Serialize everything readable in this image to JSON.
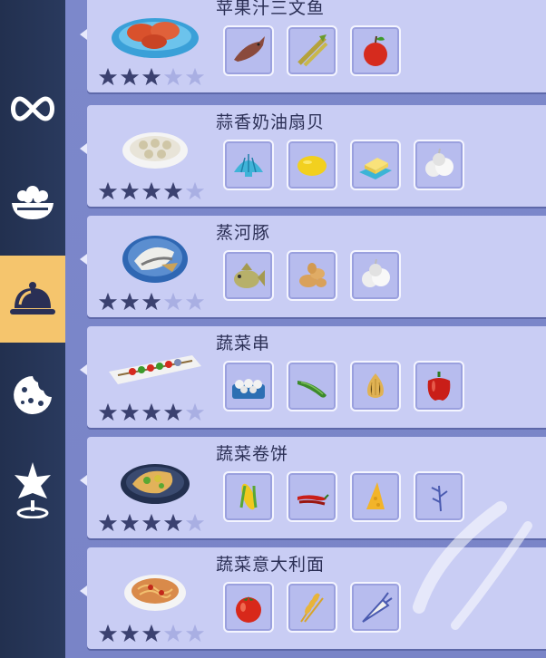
{
  "sidebar": {
    "items": [
      {
        "icon": "infinity-icon",
        "active": false
      },
      {
        "icon": "bowl-icon",
        "active": false
      },
      {
        "icon": "cloche-icon",
        "active": true
      },
      {
        "icon": "cookie-icon",
        "active": false
      },
      {
        "icon": "sparkle-pin-icon",
        "active": false
      }
    ]
  },
  "recipes": [
    {
      "name": "苹果汁三文鱼",
      "stars": 3,
      "max_stars": 5,
      "dish_icon": "salmon-dish-icon",
      "ingredients": [
        "fish-icon",
        "sugarcane-icon",
        "apple-icon"
      ]
    },
    {
      "name": "蒜香奶油扇贝",
      "stars": 4,
      "max_stars": 5,
      "dish_icon": "scallop-dish-icon",
      "ingredients": [
        "shell-icon",
        "lemon-icon",
        "butter-icon",
        "garlic-icon"
      ]
    },
    {
      "name": "蒸河豚",
      "stars": 3,
      "max_stars": 5,
      "dish_icon": "pufferfish-dish-icon",
      "ingredients": [
        "pufferfish-icon",
        "ginger-icon",
        "garlic-icon"
      ]
    },
    {
      "name": "蔬菜串",
      "stars": 4,
      "max_stars": 5,
      "dish_icon": "skewer-dish-icon",
      "ingredients": [
        "mushroom-basket-icon",
        "cucumber-icon",
        "onion-icon",
        "bell-pepper-icon"
      ]
    },
    {
      "name": "蔬菜卷饼",
      "stars": 4,
      "max_stars": 5,
      "dish_icon": "wrap-dish-icon",
      "ingredients": [
        "corn-icon",
        "chili-icon",
        "cheese-icon",
        "herb-icon"
      ]
    },
    {
      "name": "蔬菜意大利面",
      "stars": 3,
      "max_stars": 5,
      "dish_icon": "pasta-dish-icon",
      "ingredients": [
        "tomato-icon",
        "wheat-icon",
        "carrot-icon"
      ]
    }
  ],
  "colors": {
    "sidebar_bg": "#22304f",
    "active_tab": "#f5c56d",
    "card_bg": "#c9cdf4",
    "star_filled": "#3b4170",
    "star_empty": "#a9afe3"
  }
}
